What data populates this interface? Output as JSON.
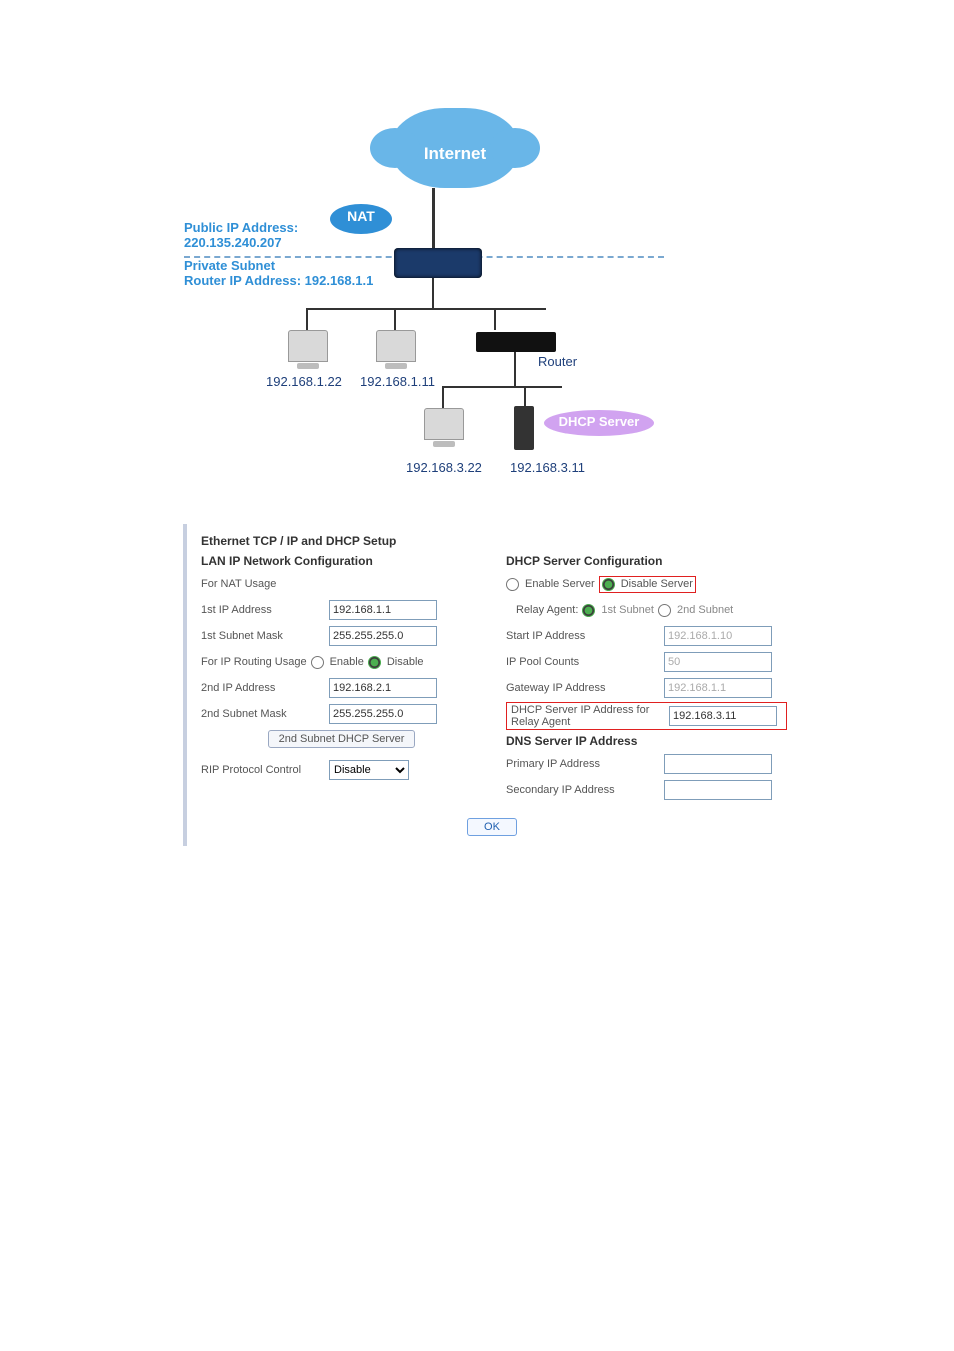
{
  "diagram": {
    "internet": "Internet",
    "nat": "NAT",
    "public_ip_label": "Public IP Address:",
    "public_ip_value": "220.135.240.207",
    "private_subnet_label": "Private Subnet",
    "router_ip_label": "Router IP Address: 192.168.1.1",
    "pc_ip_1": "192.168.1.22",
    "pc_ip_2": "192.168.1.11",
    "router_label": "Router",
    "dhcp_label": "DHCP Server",
    "sub_pc_ip": "192.168.3.22",
    "sub_srv_ip": "192.168.3.11"
  },
  "panel": {
    "title": "Ethernet TCP / IP and DHCP Setup",
    "lan": {
      "heading": "LAN IP Network Configuration",
      "nat_usage": "For NAT Usage",
      "first_ip_label": "1st IP Address",
      "first_ip_value": "192.168.1.1",
      "first_mask_label": "1st Subnet Mask",
      "first_mask_value": "255.255.255.0",
      "routing_usage": "For IP Routing Usage",
      "enable": "Enable",
      "disable": "Disable",
      "second_ip_label": "2nd IP Address",
      "second_ip_value": "192.168.2.1",
      "second_mask_label": "2nd Subnet Mask",
      "second_mask_value": "255.255.255.0",
      "second_dhcp_btn": "2nd Subnet DHCP Server",
      "rip_label": "RIP Protocol Control",
      "rip_value": "Disable"
    },
    "dhcp": {
      "heading": "DHCP Server Configuration",
      "enable_server": "Enable Server",
      "disable_server": "Disable Server",
      "relay_label": "Relay Agent:",
      "first_subnet": "1st Subnet",
      "second_subnet": "2nd Subnet",
      "start_ip_label": "Start IP Address",
      "start_ip_value": "192.168.1.10",
      "pool_label": "IP Pool Counts",
      "pool_value": "50",
      "gateway_label": "Gateway IP Address",
      "gateway_value": "192.168.1.1",
      "relay_agent_ip_label": "DHCP Server IP Address for Relay Agent",
      "relay_agent_ip_value": "192.168.3.11",
      "dns_heading": "DNS Server IP Address",
      "dns_primary_label": "Primary IP Address",
      "dns_primary_value": "",
      "dns_secondary_label": "Secondary IP Address",
      "dns_secondary_value": ""
    },
    "ok": "OK"
  }
}
